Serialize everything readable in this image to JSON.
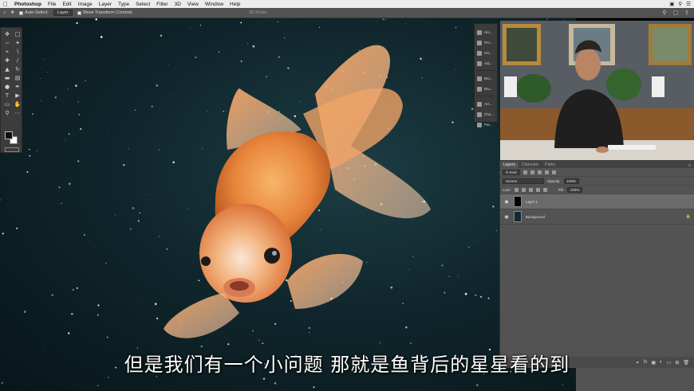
{
  "menubar": {
    "apple": "",
    "app_name": "Photoshop",
    "menus": [
      "File",
      "Edit",
      "Image",
      "Layer",
      "Type",
      "Select",
      "Filter",
      "3D",
      "View",
      "Window",
      "Help"
    ]
  },
  "options_bar": {
    "auto_select_label": "Auto-Select:",
    "auto_select_value": "Layer",
    "transform_controls_label": "Show Transform Controls",
    "mode_3d_label": "3D Mode:"
  },
  "collapsed_panels": [
    {
      "label": "His..."
    },
    {
      "label": "Pro..."
    },
    {
      "label": "His..."
    },
    {
      "label": "Adj..."
    },
    {
      "label": "Bru..."
    },
    {
      "label": "Bru..."
    },
    {
      "label": "Act..."
    },
    {
      "label": "Cha..."
    },
    {
      "label": "Par..."
    }
  ],
  "layers_panel": {
    "tabs": [
      "Layers",
      "Channels",
      "Paths"
    ],
    "active_tab": "Layers",
    "filter_kind": "Kind",
    "blend_mode": "Screen",
    "opacity_label": "Opacity:",
    "opacity_value": "100%",
    "lock_label": "Lock:",
    "fill_label": "Fill:",
    "fill_value": "100%",
    "layers": [
      {
        "name": "Layer 1",
        "selected": true,
        "visible": true
      },
      {
        "name": "Background",
        "selected": false,
        "visible": true,
        "locked": true
      }
    ]
  },
  "subtitle": "但是我们有一个小问题 那就是鱼背后的星星看的到",
  "colors": {
    "canvas_bg": "#10262c",
    "panel_bg": "#535353",
    "tools_bg": "#3c3c3c",
    "fish_orange": "#e8853c",
    "subtitle_color": "#ffffff"
  },
  "icons": {
    "menubar_right": [
      "cast-icon",
      "search-icon",
      "menu-list-icon"
    ],
    "optbar_right": [
      "search-icon",
      "workspace-icon",
      "share-icon"
    ]
  }
}
